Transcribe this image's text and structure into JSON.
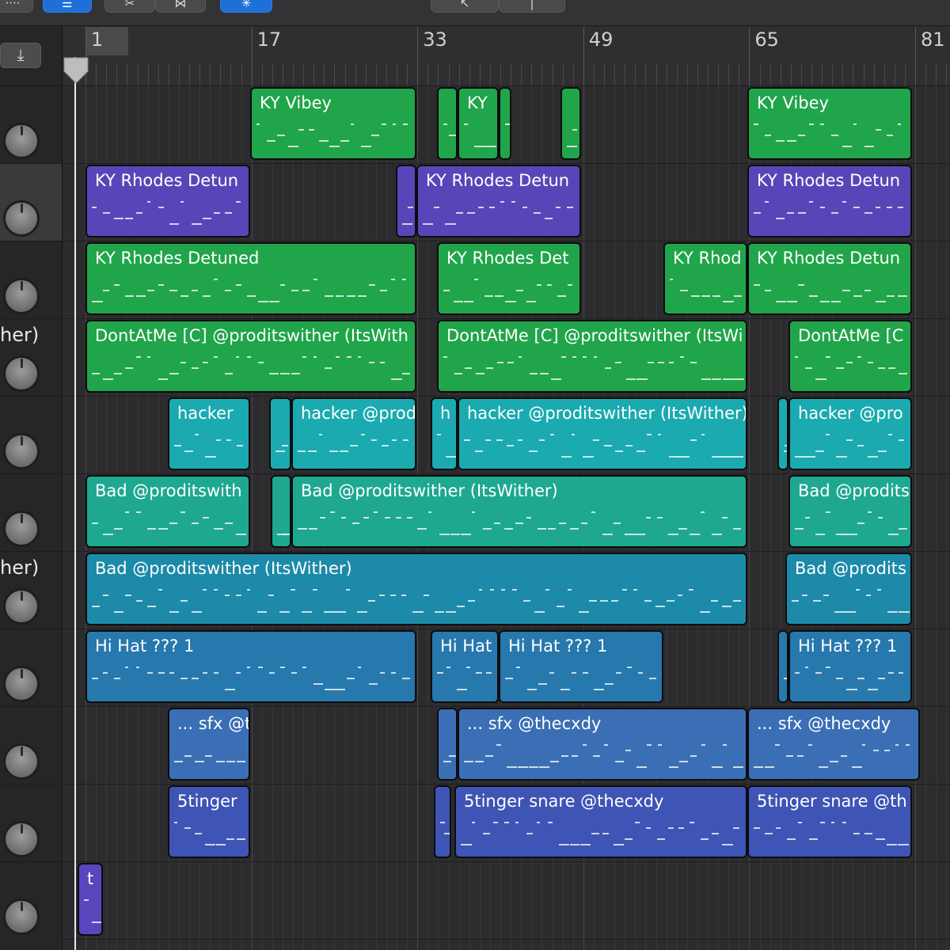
{
  "colors": {
    "green": "#20a54a",
    "purple": "#5a45b8",
    "teal": "#1aaab0",
    "teal_green": "#1ea890",
    "dark_teal": "#1c8aa8",
    "steel_blue": "#2678ad",
    "blue": "#3a6fb5",
    "indigo": "#3e55b5",
    "violet": "#5b45bd"
  },
  "ruler": {
    "bars": [
      "1",
      "17",
      "33",
      "49",
      "65",
      "81"
    ]
  },
  "track_headers": [
    {
      "name": ""
    },
    {
      "name": ""
    },
    {
      "name": ""
    },
    {
      "name": "her)"
    },
    {
      "name": ""
    },
    {
      "name": ""
    },
    {
      "name": "her)"
    },
    {
      "name": ""
    },
    {
      "name": ""
    },
    {
      "name": ""
    },
    {
      "name": ""
    }
  ],
  "regions": [
    {
      "name": "KY Vibey",
      "track": 0,
      "color": "green"
    },
    {
      "name": "",
      "track": 0,
      "color": "green"
    },
    {
      "name": "KY",
      "track": 0,
      "color": "green"
    },
    {
      "name": "",
      "track": 0,
      "color": "green"
    },
    {
      "name": "",
      "track": 0,
      "color": "green"
    },
    {
      "name": "KY Vibey",
      "track": 0,
      "color": "green"
    },
    {
      "name": "KY Rhodes Detun",
      "track": 1,
      "color": "purple"
    },
    {
      "name": "",
      "track": 1,
      "color": "purple"
    },
    {
      "name": "KY Rhodes Detun",
      "track": 1,
      "color": "purple"
    },
    {
      "name": "KY Rhodes Detun",
      "track": 1,
      "color": "purple"
    },
    {
      "name": "KY Rhodes Detuned",
      "track": 2,
      "color": "green"
    },
    {
      "name": "KY Rhodes Det",
      "track": 2,
      "color": "green"
    },
    {
      "name": "KY Rhod",
      "track": 2,
      "color": "green"
    },
    {
      "name": "KY Rhodes Detun",
      "track": 2,
      "color": "green"
    },
    {
      "name": "DontAtMe [C] @proditswither (ItsWith",
      "track": 3,
      "color": "green"
    },
    {
      "name": "DontAtMe [C] @proditswither (ItsWi",
      "track": 3,
      "color": "green"
    },
    {
      "name": "DontAtMe [C",
      "track": 3,
      "color": "green"
    },
    {
      "name": "hacker",
      "track": 4,
      "color": "teal"
    },
    {
      "name": "",
      "track": 4,
      "color": "teal"
    },
    {
      "name": "hacker @prod",
      "track": 4,
      "color": "teal"
    },
    {
      "name": "h",
      "track": 4,
      "color": "teal"
    },
    {
      "name": "hacker @proditswither (ItsWither)",
      "track": 4,
      "color": "teal"
    },
    {
      "name": "",
      "track": 4,
      "color": "teal"
    },
    {
      "name": "hacker @pro",
      "track": 4,
      "color": "teal"
    },
    {
      "name": "Bad @proditswith",
      "track": 5,
      "color": "teal_green"
    },
    {
      "name": "",
      "track": 5,
      "color": "teal_green"
    },
    {
      "name": "Bad @proditswither (ItsWither)",
      "track": 5,
      "color": "teal_green"
    },
    {
      "name": "Bad @prodits",
      "track": 5,
      "color": "teal_green"
    },
    {
      "name": "Bad @proditswither (ItsWither)",
      "track": 6,
      "color": "dark_teal"
    },
    {
      "name": "Bad @prodits",
      "track": 6,
      "color": "dark_teal"
    },
    {
      "name": "Hi Hat ??? 1",
      "track": 7,
      "color": "steel_blue"
    },
    {
      "name": "Hi Hat",
      "track": 7,
      "color": "steel_blue"
    },
    {
      "name": "Hi Hat ??? 1",
      "track": 7,
      "color": "steel_blue"
    },
    {
      "name": "",
      "track": 7,
      "color": "steel_blue"
    },
    {
      "name": "Hi Hat ??? 1",
      "track": 7,
      "color": "steel_blue"
    },
    {
      "name": "... sfx @t",
      "track": 8,
      "color": "blue"
    },
    {
      "name": "",
      "track": 8,
      "color": "blue"
    },
    {
      "name": "... sfx @thecxdy",
      "track": 8,
      "color": "blue"
    },
    {
      "name": "... sfx @thecxdy",
      "track": 8,
      "color": "blue"
    },
    {
      "name": "5tinger",
      "track": 9,
      "color": "indigo"
    },
    {
      "name": "",
      "track": 9,
      "color": "indigo"
    },
    {
      "name": "5tinger snare @thecxdy",
      "track": 9,
      "color": "indigo"
    },
    {
      "name": "5tinger snare @th",
      "track": 9,
      "color": "indigo"
    },
    {
      "name": "t",
      "track": 10,
      "color": "violet"
    }
  ],
  "toolbar": {
    "buttons": [
      {
        "icon": "grid-icon",
        "active": false
      },
      {
        "icon": "list-icon",
        "active": true
      },
      {
        "icon": "scissors-icon",
        "active": false
      },
      {
        "icon": "bowtie-icon",
        "active": false
      },
      {
        "icon": "snap-icon",
        "active": true
      },
      {
        "icon": "pointer-tool-icon",
        "active": false
      },
      {
        "icon": "pencil-tool-icon",
        "active": false
      }
    ]
  }
}
